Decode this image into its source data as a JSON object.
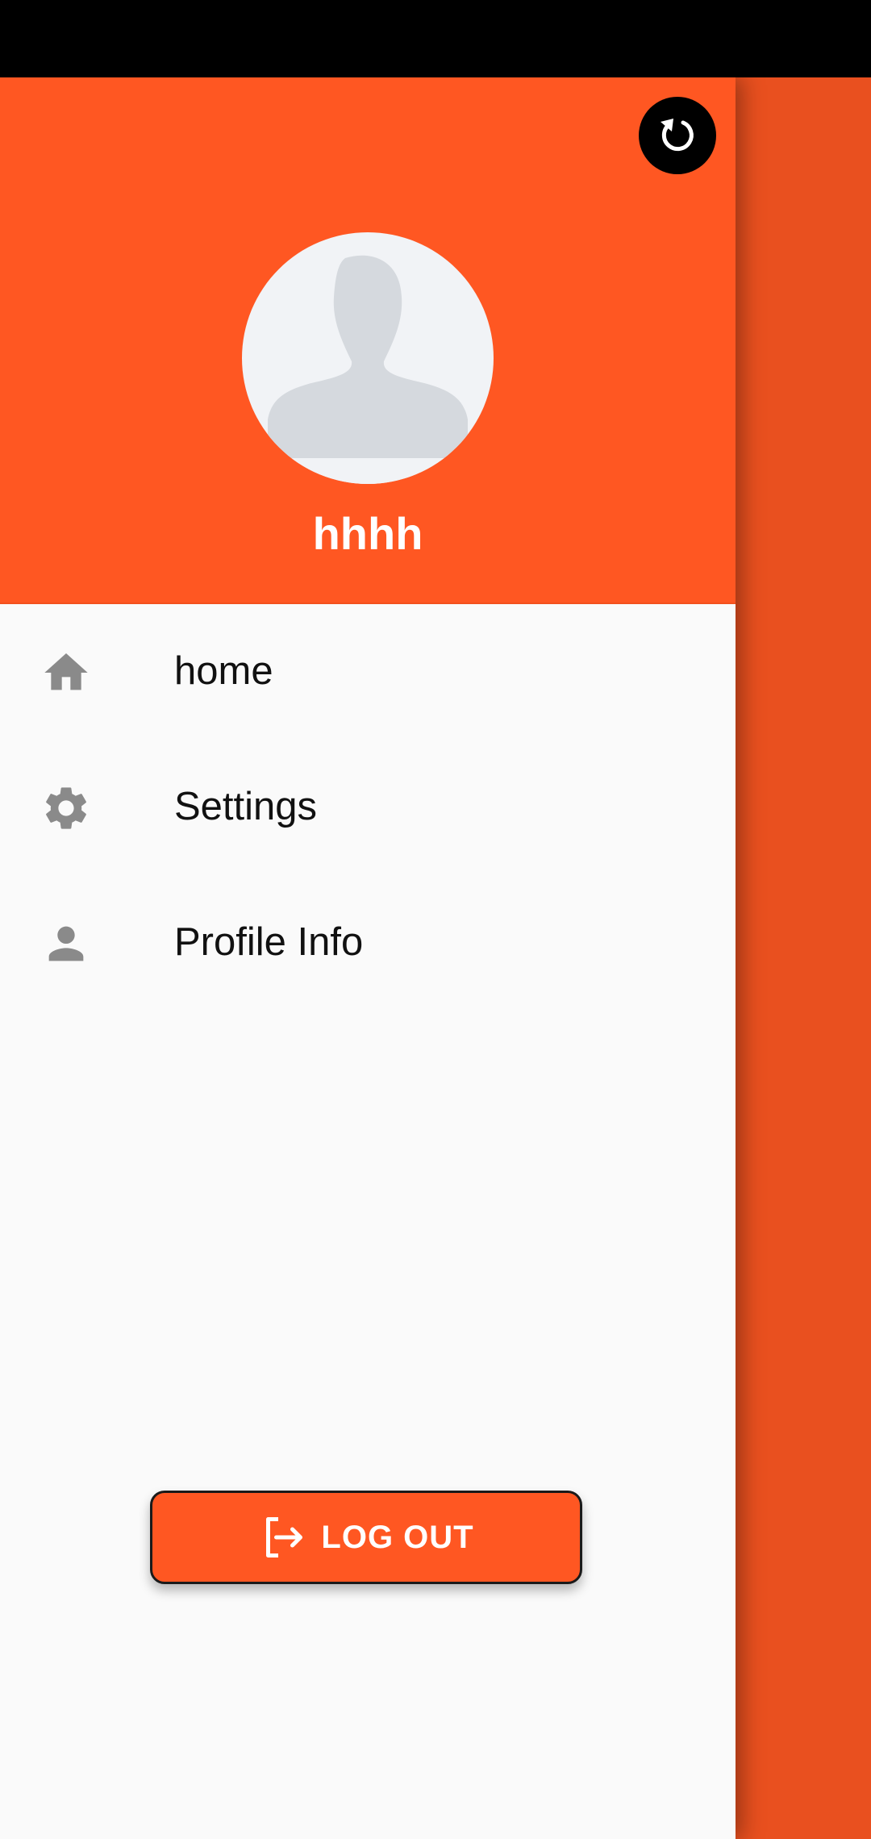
{
  "colors": {
    "status_bar": "#000000",
    "accent": "#FF5722",
    "backdrop": "#E9501F",
    "drawer_bg": "#FAFAFA",
    "icon_gray": "#8A8A8A"
  },
  "header": {
    "refresh_icon": "refresh-icon",
    "avatar_icon": "default-avatar-silhouette",
    "user_name": "hhhh"
  },
  "menu": {
    "items": [
      {
        "icon": "home-icon",
        "label": "home"
      },
      {
        "icon": "gear-icon",
        "label": "Settings"
      },
      {
        "icon": "person-icon",
        "label": "Profile Info"
      }
    ]
  },
  "logout": {
    "icon": "logout-icon",
    "label": "LOG OUT"
  }
}
